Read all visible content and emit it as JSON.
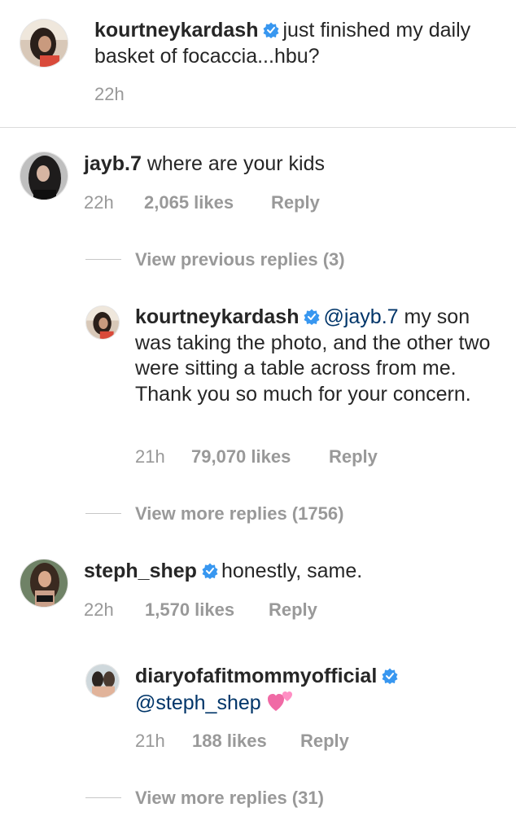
{
  "caption": {
    "username": "kourtneykardash",
    "text": "just finished my daily basket of focaccia...hbu?",
    "time": "22h"
  },
  "comments": [
    {
      "username": "jayb.7",
      "text": "where are your kids",
      "time": "22h",
      "likes": "2,065 likes",
      "reply_label": "Reply",
      "view_replies": "View previous replies (3)",
      "reply": {
        "username": "kourtneykardash",
        "mention": "@jayb.7",
        "text_line1": "my son",
        "text_rest": "was taking the photo, and the other two were sitting a table across from me. Thank you so much for your concern.",
        "time": "21h",
        "likes": "79,070 likes",
        "reply_label": "Reply"
      },
      "view_more": "View more replies (1756)"
    },
    {
      "username": "steph_shep",
      "text": "honestly, same.",
      "time": "22h",
      "likes": "1,570 likes",
      "reply_label": "Reply",
      "reply": {
        "username": "diaryofafitmommyofficial",
        "mention": "@steph_shep",
        "emoji": "two-hearts",
        "time": "21h",
        "likes": "188 likes",
        "reply_label": "Reply"
      },
      "view_more": "View more replies (31)"
    }
  ],
  "colors": {
    "text": "#262626",
    "meta": "#999999",
    "mention": "#003569",
    "verified": "#3897f0",
    "divider": "#dbdbdb"
  }
}
